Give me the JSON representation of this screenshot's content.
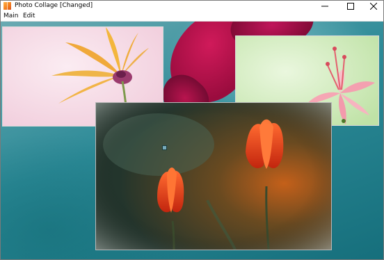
{
  "window": {
    "title": "Photo Collage [Changed]",
    "icon": "app-icon",
    "controls": [
      "minimize-icon",
      "maximize-icon",
      "close-icon"
    ]
  },
  "menu": {
    "items": [
      {
        "label": "Main"
      },
      {
        "label": "Edit"
      }
    ]
  },
  "canvas": {
    "background": "teal flower photo",
    "photos": [
      {
        "name": "yellow flower on pink"
      },
      {
        "name": "pink flower on green"
      },
      {
        "name": "red tulips"
      }
    ]
  },
  "colors": {
    "background_teal": "#2c8a97",
    "accent_red": "#e8451c",
    "pink": "#f6dbe6",
    "green": "#d9efc9"
  }
}
